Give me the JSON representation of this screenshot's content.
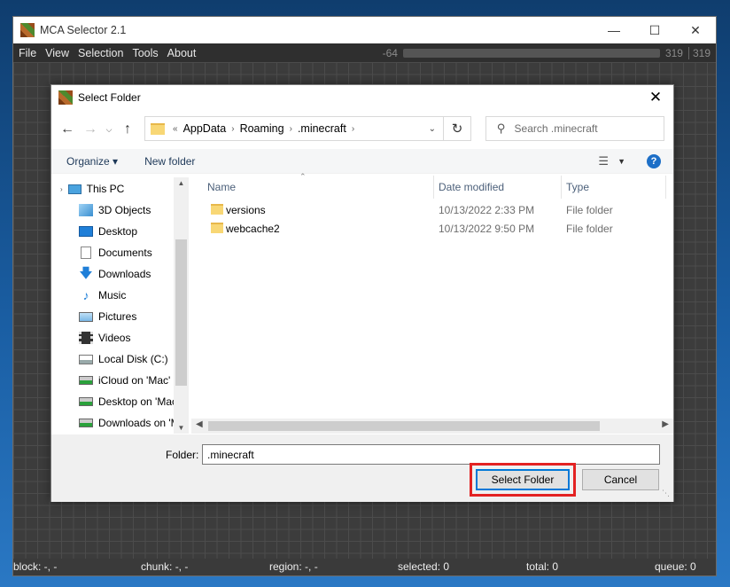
{
  "app": {
    "title": "MCA Selector 2.1",
    "menu": [
      "File",
      "View",
      "Selection",
      "Tools",
      "About"
    ],
    "slider_min": "-64",
    "slider_max": "319",
    "slider_value": "319"
  },
  "status": {
    "block": "block: -, -",
    "chunk": "chunk: -, -",
    "region": "region: -, -",
    "selected": "selected: 0",
    "total": "total: 0",
    "queue": "queue: 0"
  },
  "dialog": {
    "title": "Select Folder",
    "breadcrumb": [
      "AppData",
      "Roaming",
      ".minecraft"
    ],
    "breadcrumb_overflow": "«",
    "search_placeholder": "Search .minecraft",
    "toolbar": {
      "organize": "Organize",
      "new_folder": "New folder"
    },
    "nav_items": [
      {
        "label": "This PC",
        "icon": "computer-icon"
      },
      {
        "label": "3D Objects",
        "icon": "cube-icon"
      },
      {
        "label": "Desktop",
        "icon": "desktop-icon"
      },
      {
        "label": "Documents",
        "icon": "document-icon"
      },
      {
        "label": "Downloads",
        "icon": "download-icon"
      },
      {
        "label": "Music",
        "icon": "music-icon"
      },
      {
        "label": "Pictures",
        "icon": "picture-icon"
      },
      {
        "label": "Videos",
        "icon": "video-icon"
      },
      {
        "label": "Local Disk (C:)",
        "icon": "disk-icon"
      },
      {
        "label": "iCloud on 'Mac'",
        "icon": "network-drive-icon"
      },
      {
        "label": "Desktop on 'Mac'",
        "icon": "network-drive-icon"
      },
      {
        "label": "Downloads on 'M",
        "icon": "network-drive-icon"
      }
    ],
    "columns": {
      "name": "Name",
      "date": "Date modified",
      "type": "Type"
    },
    "rows": [
      {
        "name": "versions",
        "date": "10/13/2022 2:33 PM",
        "type": "File folder"
      },
      {
        "name": "webcache2",
        "date": "10/13/2022 9:50 PM",
        "type": "File folder"
      }
    ],
    "folder_label": "Folder:",
    "folder_value": ".minecraft",
    "select_button": "Select Folder",
    "cancel_button": "Cancel"
  },
  "colors": {
    "accent": "#0078d7",
    "highlight": "#e32222",
    "help": "#1d6fc7"
  }
}
